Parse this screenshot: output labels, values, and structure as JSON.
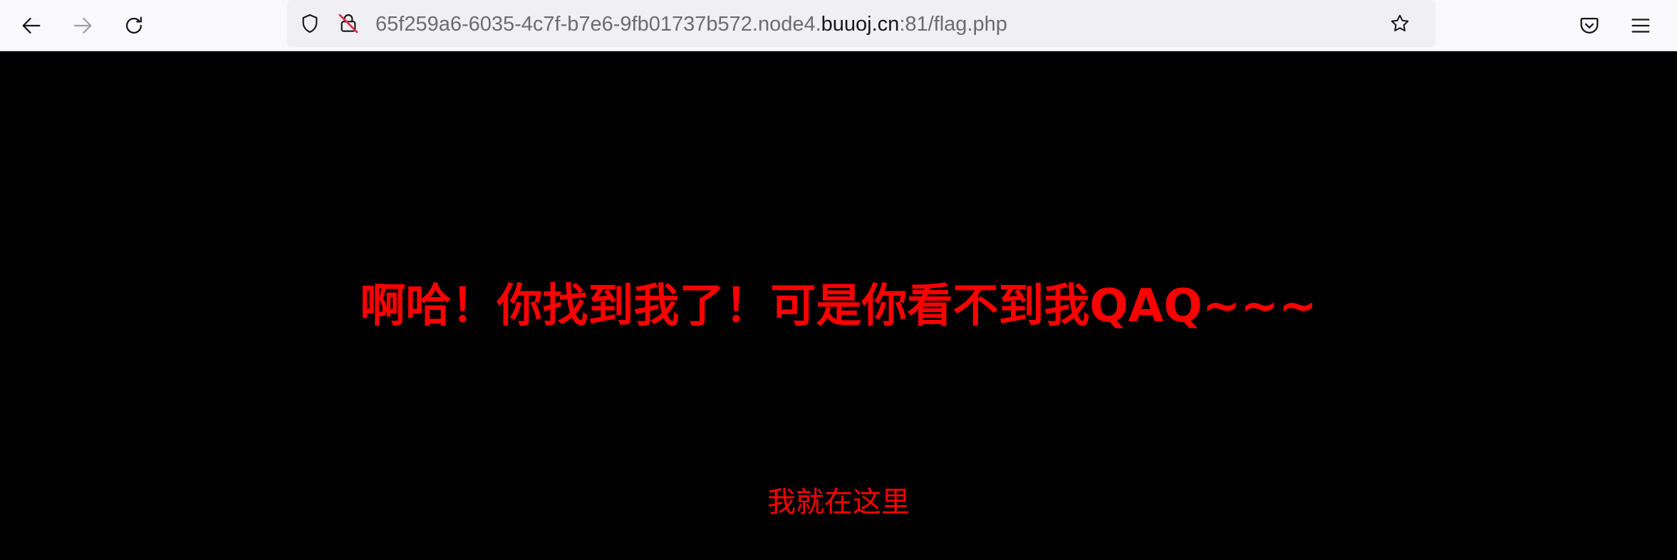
{
  "toolbar": {
    "icons": {
      "back": "back-arrow-icon",
      "forward": "forward-arrow-icon",
      "reload": "reload-icon",
      "tracking_protection": "shield-icon",
      "connection": "insecure-lock-icon",
      "bookmark": "star-icon",
      "pocket": "pocket-icon",
      "menu": "hamburger-menu-icon"
    },
    "url": {
      "prefix": "65f259a6-6035-4c7f-b7e6-9fb01737b572.node4.",
      "domain": "buuoj.cn",
      "suffix": ":81/flag.php"
    }
  },
  "page": {
    "headline": "啊哈！你找到我了！可是你看不到我QAQ~~~",
    "subtext": "我就在这里"
  },
  "colors": {
    "background": "#000000",
    "text": "#ff0000",
    "toolbar": "#f9f9fb",
    "urlbar": "#f0f0f4"
  }
}
